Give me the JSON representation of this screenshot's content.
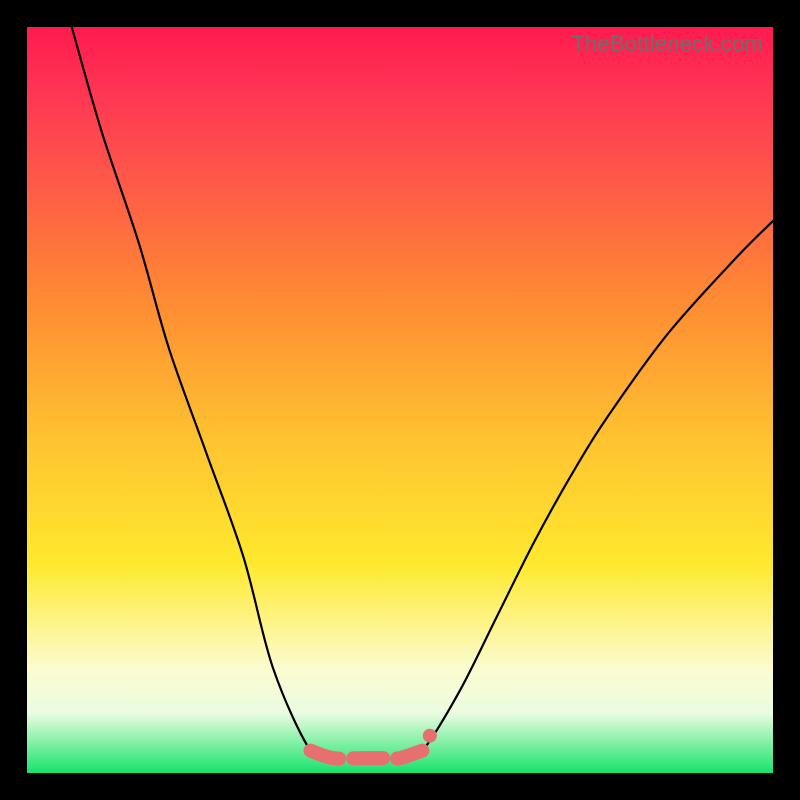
{
  "watermark": "TheBottleneck.com",
  "colors": {
    "curve_stroke": "#000000",
    "marker_fill": "#e86f6f",
    "marker_stroke": "#e86f6f"
  },
  "chart_data": {
    "type": "line",
    "title": "",
    "xlabel": "",
    "ylabel": "",
    "xlim": [
      0,
      100
    ],
    "ylim": [
      0,
      100
    ],
    "series": [
      {
        "name": "left-curve",
        "x": [
          6,
          10,
          15,
          19,
          24,
          29,
          33,
          38,
          41
        ],
        "y": [
          100,
          86,
          71,
          57,
          43,
          29,
          14,
          3,
          2
        ]
      },
      {
        "name": "right-curve",
        "x": [
          50,
          53,
          58,
          63,
          68,
          73,
          78,
          86,
          95,
          100
        ],
        "y": [
          2,
          3,
          11,
          21,
          31,
          40,
          48,
          59,
          69,
          74
        ]
      }
    ],
    "markers": {
      "name": "highlight-segment",
      "points": [
        {
          "x": 38,
          "y": 3
        },
        {
          "x": 41,
          "y": 2
        },
        {
          "x": 45,
          "y": 2
        },
        {
          "x": 48,
          "y": 2
        },
        {
          "x": 50,
          "y": 2
        },
        {
          "x": 53,
          "y": 3
        }
      ]
    }
  }
}
